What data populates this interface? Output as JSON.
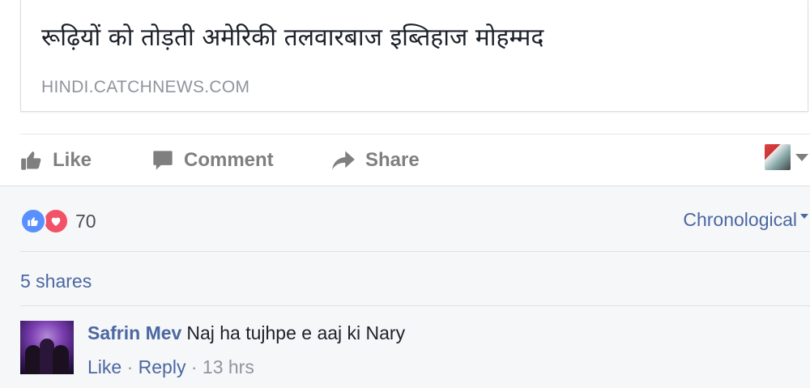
{
  "link_preview": {
    "title": "रूढ़ियों को तोड़ती अमेरिकी तलवारबाज इब्तिहाज मोहम्मद",
    "domain": "HINDI.CATCHNEWS.COM"
  },
  "actions": {
    "like_label": "Like",
    "comment_label": "Comment",
    "share_label": "Share",
    "like_icon": "thumbs-up-icon",
    "comment_icon": "speech-bubble-icon",
    "share_icon": "share-arrow-icon"
  },
  "feedback": {
    "reaction_count": "70",
    "reaction_types": [
      "like",
      "love"
    ],
    "sort_label": "Chronological",
    "shares_label": "5 shares"
  },
  "comments": [
    {
      "author": "Safrin Mev",
      "text": "Naj ha tujhpe e aaj ki Nary",
      "like_label": "Like",
      "separator": "·",
      "reply_label": "Reply",
      "time": "13 hrs"
    }
  ],
  "colors": {
    "link_blue": "#4b67a1",
    "action_grey": "#7f7f7f",
    "like_blue": "#5890ff",
    "love_red": "#f25268",
    "feedback_bg": "#f6f7f9"
  }
}
